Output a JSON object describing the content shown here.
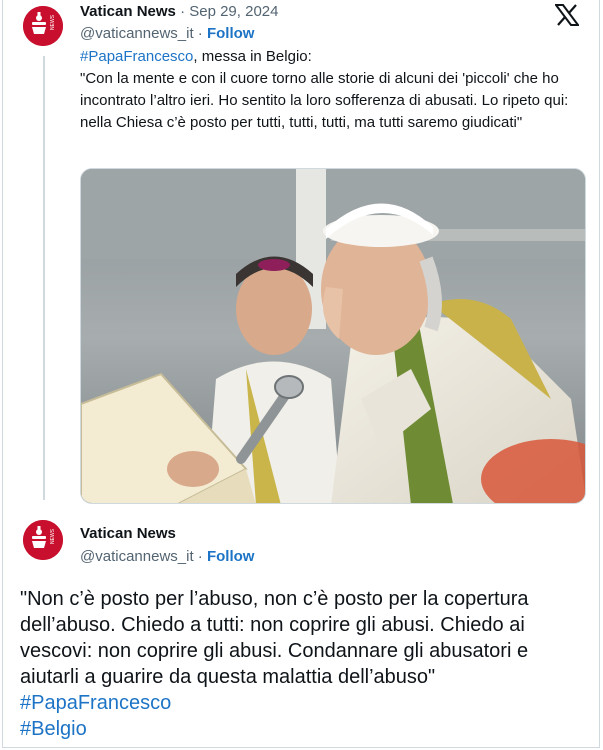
{
  "quoted_tweet": {
    "author_name": "Vatican News",
    "separator": "·",
    "date": "Sep 29, 2024",
    "handle": "@vaticannews_it",
    "follow_label": "Follow",
    "hashtag": "#PapaFrancesco",
    "lead": ", messa in Belgio:",
    "body": "\"Con la mente e con il cuore torno alle storie di alcuni dei 'piccoli' che ho incontrato l’altro ieri. Ho sentito la loro sofferenza di abusati. Lo ripeto qui: nella Chiesa c’è posto per tutti, tutti, tutti, ma tutti saremo giudicati\"",
    "avatar_badge_text": "NEWS",
    "photo_icon": "photo-of-pope-speaking-at-microphone"
  },
  "reply_tweet": {
    "author_name": "Vatican News",
    "handle": "@vaticannews_it",
    "follow_label": "Follow",
    "avatar_badge_text": "NEWS",
    "text": "\"Non c’è posto per l’abuso, non c’è posto per la copertura dell’abuso. Chiedo a tutti: non coprire gli abusi. Chiedo ai vescovi: non coprire gli abusi. Condannare gli abusatori e aiutarli a guarire da questa malattia dell’abuso\"",
    "hashtags": [
      "#PapaFrancesco",
      "#Belgio"
    ]
  },
  "icons": {
    "platform": "x-logo-icon"
  },
  "colors": {
    "accent": "#1d74c6",
    "brand_red": "#c8102e",
    "muted": "#536471",
    "border": "#cfd9de"
  }
}
